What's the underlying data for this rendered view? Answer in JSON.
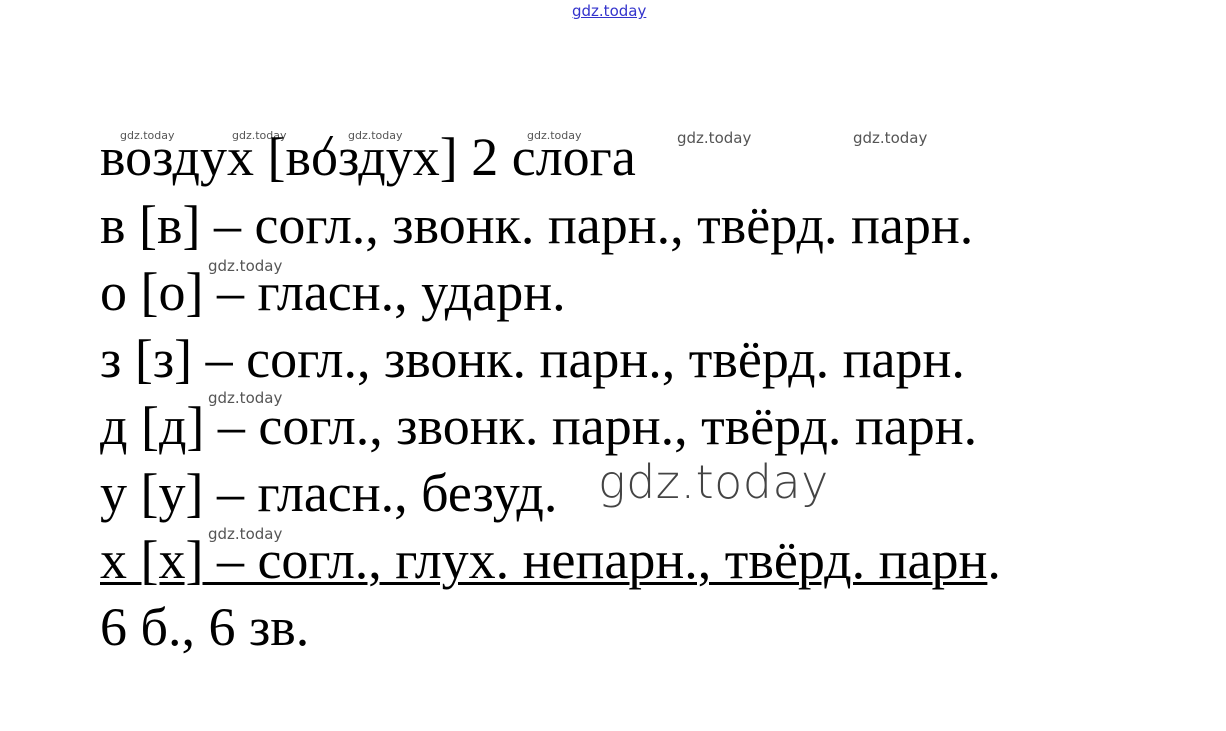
{
  "watermarks": {
    "top": "gdz.today",
    "small": "gdz.today",
    "large": "gdz.today"
  },
  "lines": {
    "l1_pre": "воздух [в",
    "l1_stressed": "о",
    "l1_post": "здух] 2 слога",
    "l2": "в [в] – согл., звонк. парн., твёрд. парн.",
    "l3": "о [о] – гласн., ударн.",
    "l4": "з [з] – согл., звонк. парн., твёрд. парн.",
    "l5": "д [д] – согл., звонк. парн., твёрд. парн.",
    "l6": "у [у] – гласн., безуд.",
    "l7_underlined": "х [х] – согл., глух. непарн., твёрд. парн",
    "l7_tail": ".",
    "l8": "6 б., 6 зв."
  }
}
